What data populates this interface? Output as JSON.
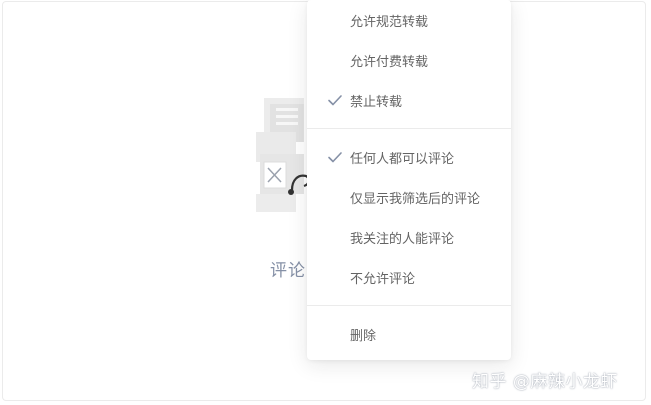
{
  "empty_state": {
    "label": "评论"
  },
  "menu": {
    "repost_group": [
      {
        "label": "允许规范转载",
        "checked": false
      },
      {
        "label": "允许付费转载",
        "checked": false
      },
      {
        "label": "禁止转载",
        "checked": true
      }
    ],
    "comment_group": [
      {
        "label": "任何人都可以评论",
        "checked": true
      },
      {
        "label": "仅显示我筛选后的评论",
        "checked": false
      },
      {
        "label": "我关注的人能评论",
        "checked": false
      },
      {
        "label": "不允许评论",
        "checked": false
      }
    ],
    "delete_label": "删除",
    "check_icon": "check-icon",
    "check_color": "#8590a6"
  },
  "watermark": {
    "text": "知乎 @麻辣小龙虾"
  }
}
